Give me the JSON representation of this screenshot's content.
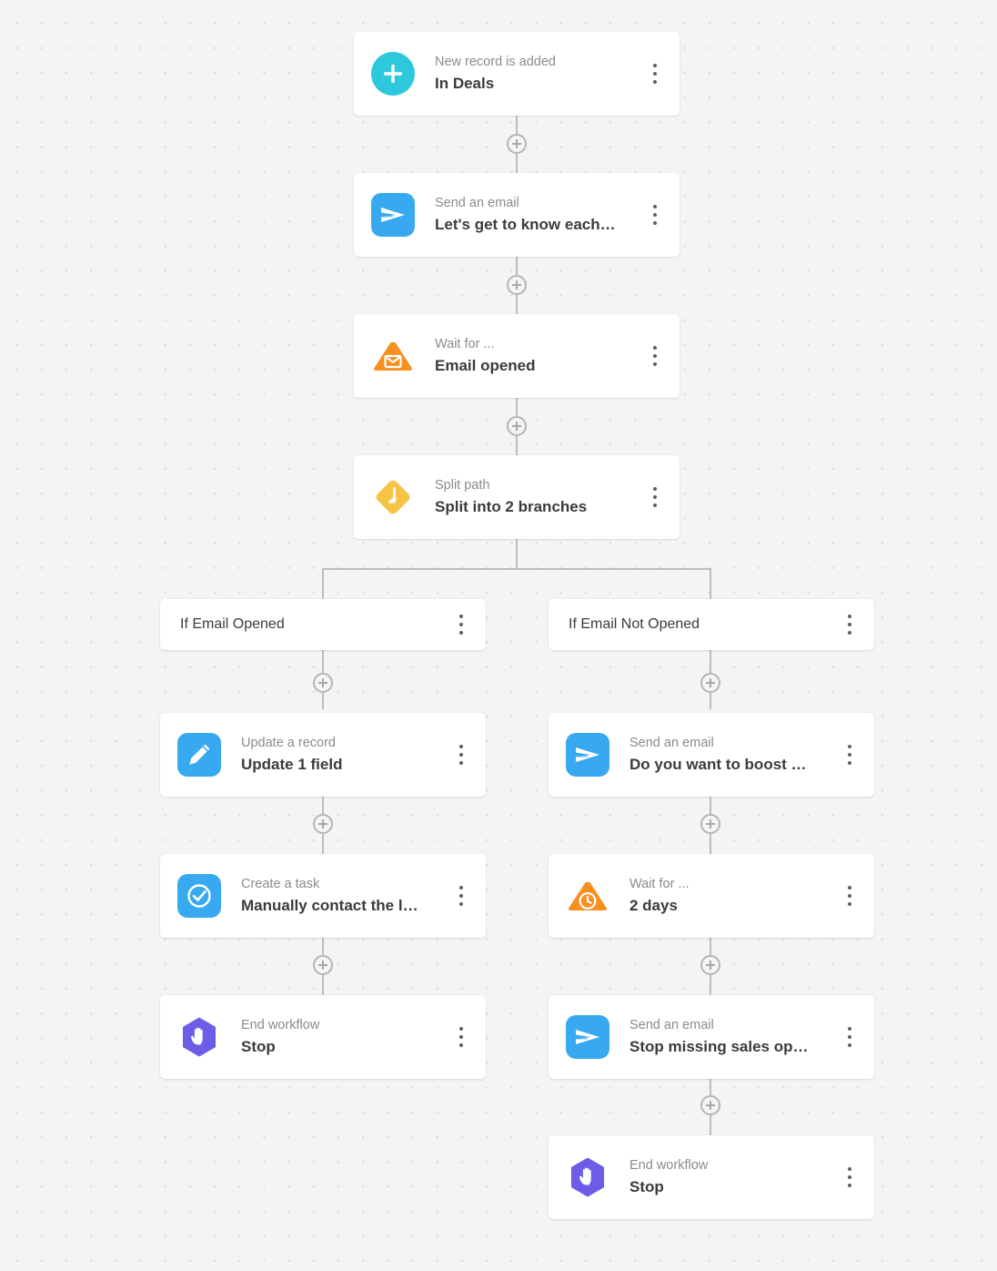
{
  "canvas": {
    "background_color": "#f4f4f4",
    "dot_color": "#d8d8d8",
    "connector_color": "#bdbdbd"
  },
  "kebab_label": "More options",
  "nodes": {
    "trigger": {
      "subtitle": "New record is added",
      "title": "In Deals",
      "icon": "plus-circle-icon",
      "icon_color": "#2ec8dd"
    },
    "send_email_1": {
      "subtitle": "Send an email",
      "title": "Let's get to know each…",
      "icon": "send-email-icon",
      "icon_color": "#38a9f0"
    },
    "wait_email_opened": {
      "subtitle": "Wait for ...",
      "title": "Email opened",
      "icon": "envelope-triangle-icon",
      "icon_color": "#f7901e"
    },
    "split_path": {
      "subtitle": "Split path",
      "title": "Split into 2 branches",
      "icon": "split-path-icon",
      "icon_color": "#f6c344"
    },
    "branch_left": {
      "title": "If Email Opened"
    },
    "branch_right": {
      "title": "If Email Not Opened"
    },
    "update_record": {
      "subtitle": "Update a record",
      "title": "Update 1 field",
      "icon": "pencil-icon",
      "icon_color": "#38a9f0"
    },
    "create_task": {
      "subtitle": "Create a task",
      "title": "Manually contact the l…",
      "icon": "check-circle-icon",
      "icon_color": "#38a9f0"
    },
    "end_left": {
      "subtitle": "End workflow",
      "title": "Stop",
      "icon": "stop-hand-icon",
      "icon_color": "#6c5ce7"
    },
    "send_email_2": {
      "subtitle": "Send an email",
      "title": "Do you want to boost …",
      "icon": "send-email-icon",
      "icon_color": "#38a9f0"
    },
    "wait_2_days": {
      "subtitle": "Wait for ...",
      "title": "2 days",
      "icon": "clock-triangle-icon",
      "icon_color": "#f7901e"
    },
    "send_email_3": {
      "subtitle": "Send an email",
      "title": "Stop missing sales op…",
      "icon": "send-email-icon",
      "icon_color": "#38a9f0"
    },
    "end_right": {
      "subtitle": "End workflow",
      "title": "Stop",
      "icon": "stop-hand-icon",
      "icon_color": "#6c5ce7"
    }
  }
}
